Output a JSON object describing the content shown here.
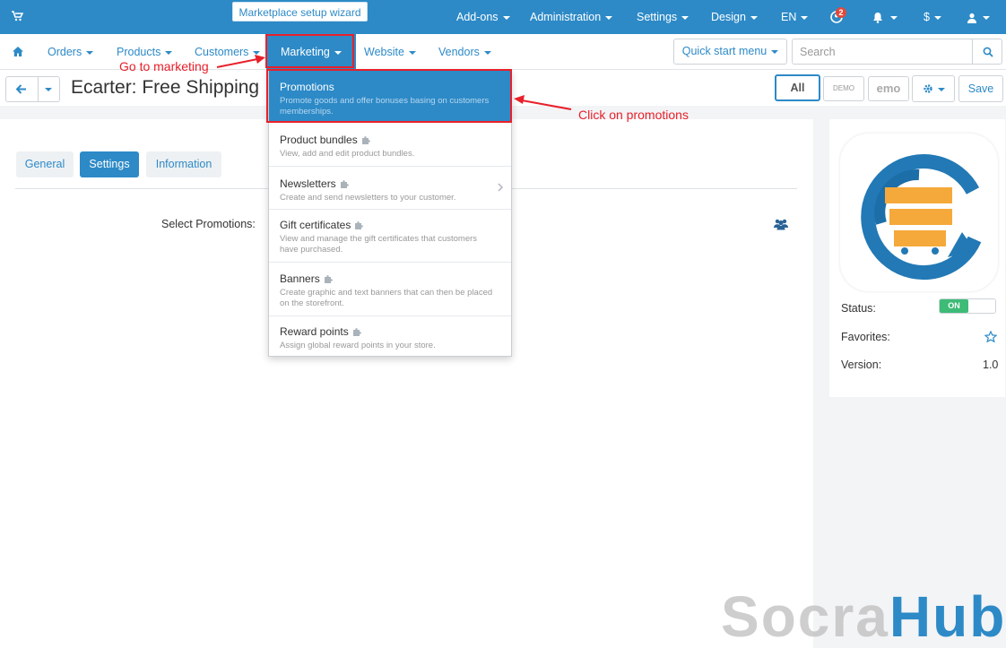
{
  "topbar": {
    "wizard_label": "Marketplace setup wizard",
    "addons": "Add-ons",
    "administration": "Administration",
    "settings": "Settings",
    "design": "Design",
    "language": "EN",
    "notif_count": "2",
    "currency": "$",
    "icons": [
      "cart-icon",
      "user-profile-icon",
      "bell-icon",
      "user-icon"
    ]
  },
  "nav": {
    "orders": "Orders",
    "products": "Products",
    "customers": "Customers",
    "marketing": "Marketing",
    "website": "Website",
    "vendors": "Vendors",
    "quick_start": "Quick start menu",
    "search_placeholder": "Search"
  },
  "titlebar": {
    "title": "Ecarter: Free Shipping",
    "all_label": "All",
    "demo1": "DEMO STORE",
    "demo2": "emo Sto",
    "save_label": "Save"
  },
  "tabs": {
    "general": "General",
    "settings": "Settings",
    "information": "Information"
  },
  "form": {
    "select_promotions_label": "Select Promotions:"
  },
  "side": {
    "status_label": "Status:",
    "status_value": "ON",
    "favorites_label": "Favorites:",
    "version_label": "Version:",
    "version_value": "1.0"
  },
  "menu": {
    "items": [
      {
        "title": "Promotions",
        "desc": "Promote goods and offer bonuses basing on customers memberships."
      },
      {
        "title": "Product bundles",
        "desc": "View, add and edit product bundles."
      },
      {
        "title": "Newsletters",
        "desc": "Create and send newsletters to your customer."
      },
      {
        "title": "Gift certificates",
        "desc": "View and manage the gift certificates that customers have purchased."
      },
      {
        "title": "Banners",
        "desc": "Create graphic and text banners that can then be placed on the storefront."
      },
      {
        "title": "Reward points",
        "desc": "Assign global reward points in your store."
      }
    ]
  },
  "annotations": {
    "go_to_marketing": "Go to marketing",
    "click_on_promotions": "Click on promotions",
    "color": "#e8202a"
  },
  "watermark": {
    "part1": "Socra",
    "part2": "Hub"
  },
  "colors": {
    "primary": "#2d8ac7",
    "status_on": "#3dbb77",
    "badge": "#e04a3b",
    "logo_blue": "#2279b5",
    "logo_orange": "#f5a93a"
  }
}
